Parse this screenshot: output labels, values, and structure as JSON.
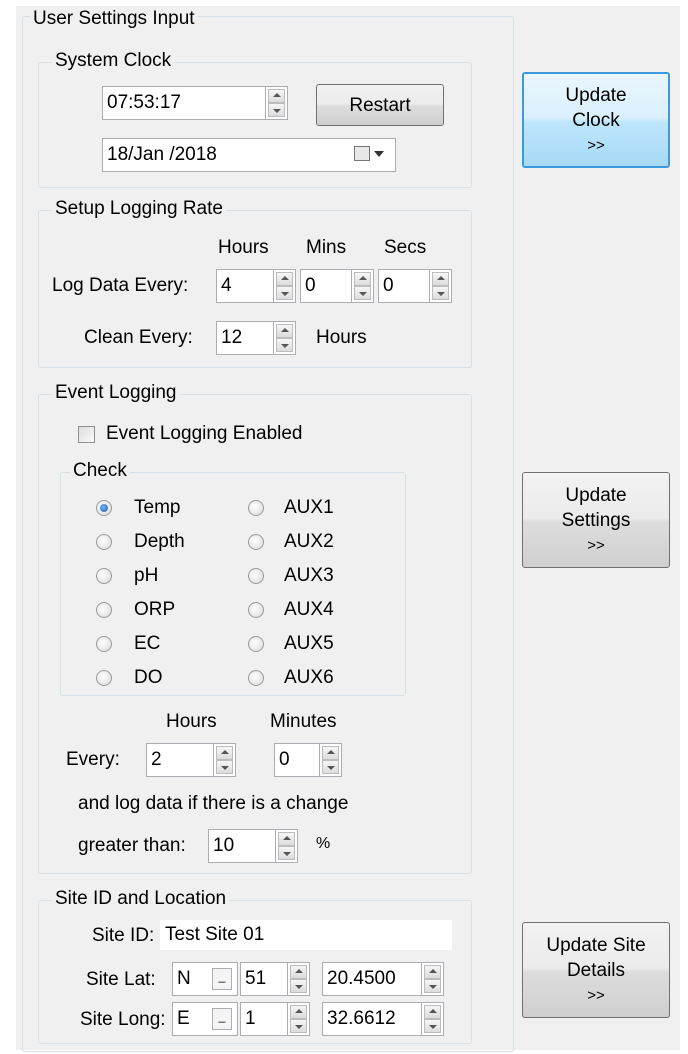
{
  "window": {
    "title": "User Settings Input"
  },
  "system_clock": {
    "title": "System Clock",
    "time": "07:53:17",
    "restart_label": "Restart",
    "date": "18/Jan /2018"
  },
  "buttons": {
    "update_clock": {
      "line1": "Update",
      "line2": "Clock",
      "line3": ">>"
    },
    "update_settings": {
      "line1": "Update",
      "line2": "Settings",
      "line3": ">>"
    },
    "update_site": {
      "line1": "Update Site",
      "line2": "Details",
      "line3": ">>"
    }
  },
  "logging_rate": {
    "title": "Setup Logging Rate",
    "col_hours": "Hours",
    "col_mins": "Mins",
    "col_secs": "Secs",
    "log_label": "Log Data Every:",
    "log_hours": "4",
    "log_mins": "0",
    "log_secs": "0",
    "clean_label": "Clean Every:",
    "clean_value": "12",
    "clean_unit": "Hours"
  },
  "event_logging": {
    "title": "Event Logging",
    "enabled_label": "Event Logging Enabled",
    "enabled": false,
    "check_title": "Check",
    "options_left": [
      "Temp",
      "Depth",
      "pH",
      "ORP",
      "EC",
      "DO"
    ],
    "options_right": [
      "AUX1",
      "AUX2",
      "AUX3",
      "AUX4",
      "AUX5",
      "AUX6"
    ],
    "selected": "Temp",
    "col_hours": "Hours",
    "col_minutes": "Minutes",
    "every_label": "Every:",
    "every_hours": "2",
    "every_minutes": "0",
    "change_text": "and log data if there is a change",
    "greater_label": "greater than:",
    "greater_value": "10",
    "percent": "%"
  },
  "site": {
    "title": "Site ID and Location",
    "id_label": "Site ID:",
    "id_value": "Test Site 01",
    "lat_label": "Site Lat:",
    "lat_dir": "N",
    "lat_deg": "51",
    "lat_min": "20.4500",
    "long_label": "Site Long:",
    "long_dir": "E",
    "long_deg": "1",
    "long_min": "32.6612"
  }
}
